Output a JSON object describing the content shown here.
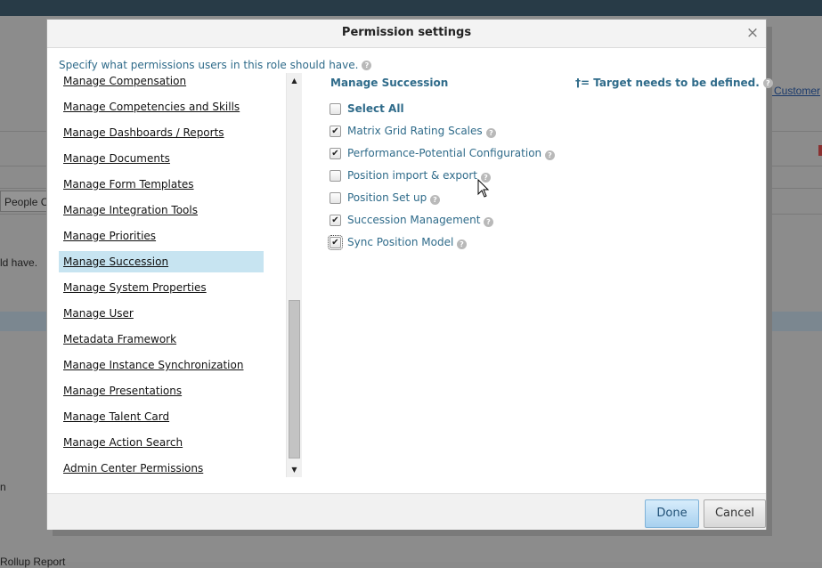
{
  "background": {
    "customer_link": "o Customer",
    "tab_label": "People C",
    "side_text": "ld have.",
    "letter_n": "n",
    "bottom_text": "Rollup Report"
  },
  "dialog": {
    "title": "Permission settings",
    "close_label": "×",
    "intro": "Specify what permissions users in this role should have.",
    "help_glyph": "?"
  },
  "left_list": {
    "items": [
      {
        "label": "Manage Compensation"
      },
      {
        "label": "Manage Competencies and Skills"
      },
      {
        "label": "Manage Dashboards / Reports"
      },
      {
        "label": "Manage Documents"
      },
      {
        "label": "Manage Form Templates"
      },
      {
        "label": "Manage Integration Tools"
      },
      {
        "label": "Manage Priorities"
      },
      {
        "label": "Manage Succession"
      },
      {
        "label": "Manage System Properties"
      },
      {
        "label": "Manage User"
      },
      {
        "label": "Metadata Framework"
      },
      {
        "label": "Manage Instance Synchronization"
      },
      {
        "label": "Manage Presentations"
      },
      {
        "label": "Manage Talent Card"
      },
      {
        "label": "Manage Action Search"
      },
      {
        "label": "Admin Center Permissions"
      }
    ],
    "selected": "Manage Succession",
    "scroll_up": "▲",
    "scroll_down": "▼"
  },
  "right_panel": {
    "section_title": "Manage Succession",
    "target_note": "†= Target needs to be defined.",
    "check_glyph": "✔",
    "select_all": {
      "label": "Select All",
      "checked": false
    },
    "options": [
      {
        "label": "Matrix Grid Rating Scales",
        "checked": true
      },
      {
        "label": "Performance-Potential Configuration",
        "checked": true
      },
      {
        "label": "Position import & export",
        "checked": false
      },
      {
        "label": "Position Set up",
        "checked": false
      },
      {
        "label": "Succession Management",
        "checked": true
      },
      {
        "label": "Sync Position Model",
        "checked": true
      }
    ]
  },
  "footer": {
    "done_label": "Done",
    "cancel_label": "Cancel"
  },
  "colors": {
    "accent_text": "#2f6b8a",
    "selected_bg": "#c7e4f1",
    "done_button": "#a8d1ef"
  }
}
